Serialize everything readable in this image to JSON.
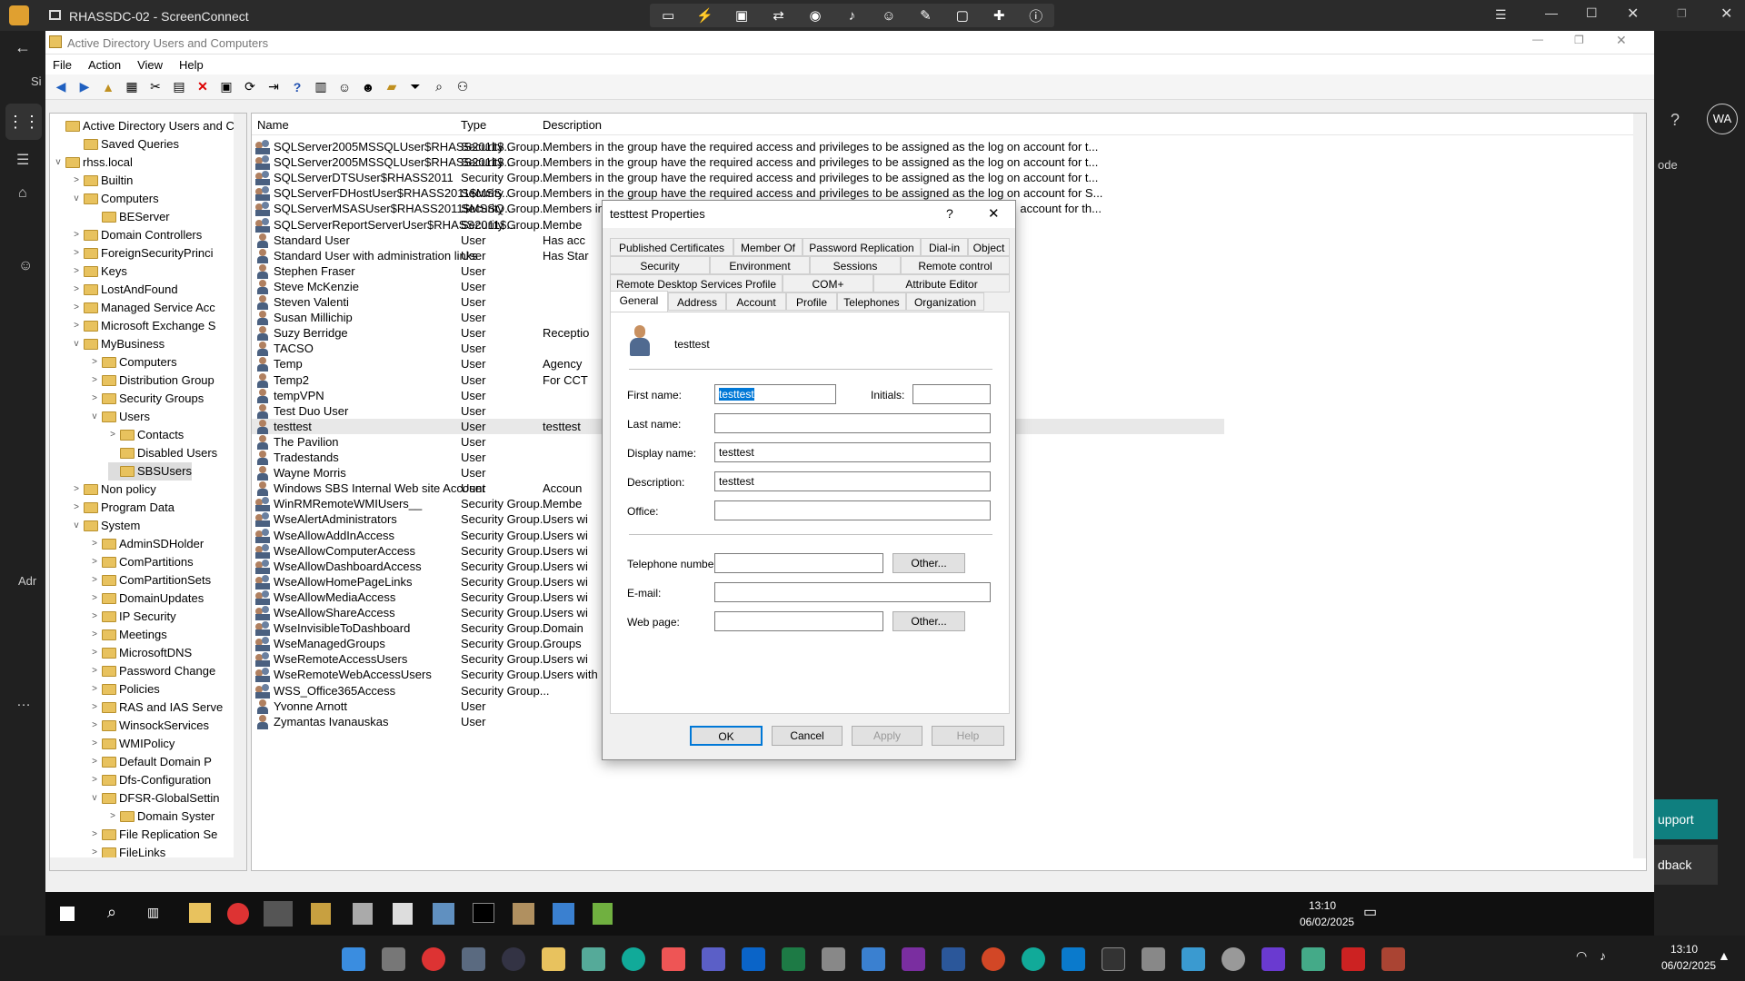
{
  "host": {
    "title": "RHASSDC-02 - ScreenConnect",
    "clock_time": "13:10",
    "clock_date": "06/02/2025"
  },
  "aduc": {
    "title": "Active Directory Users and Computers",
    "menu": [
      "File",
      "Action",
      "View",
      "Help"
    ]
  },
  "tree": [
    {
      "label": "Active Directory Users and Co",
      "indent": 0,
      "exp": ""
    },
    {
      "label": "Saved Queries",
      "indent": 1,
      "exp": ""
    },
    {
      "label": "rhss.local",
      "indent": 0,
      "exp": "v"
    },
    {
      "label": "Builtin",
      "indent": 1,
      "exp": ">"
    },
    {
      "label": "Computers",
      "indent": 1,
      "exp": "v"
    },
    {
      "label": "BEServer",
      "indent": 2,
      "exp": ""
    },
    {
      "label": "Domain Controllers",
      "indent": 1,
      "exp": ">"
    },
    {
      "label": "ForeignSecurityPrinci",
      "indent": 1,
      "exp": ">"
    },
    {
      "label": "Keys",
      "indent": 1,
      "exp": ">"
    },
    {
      "label": "LostAndFound",
      "indent": 1,
      "exp": ">"
    },
    {
      "label": "Managed Service Acc",
      "indent": 1,
      "exp": ">"
    },
    {
      "label": "Microsoft Exchange S",
      "indent": 1,
      "exp": ">"
    },
    {
      "label": "MyBusiness",
      "indent": 1,
      "exp": "v"
    },
    {
      "label": "Computers",
      "indent": 2,
      "exp": ">"
    },
    {
      "label": "Distribution Group",
      "indent": 2,
      "exp": ">"
    },
    {
      "label": "Security Groups",
      "indent": 2,
      "exp": ">"
    },
    {
      "label": "Users",
      "indent": 2,
      "exp": "v"
    },
    {
      "label": "Contacts",
      "indent": 3,
      "exp": ">"
    },
    {
      "label": "Disabled Users",
      "indent": 3,
      "exp": ""
    },
    {
      "label": "SBSUsers",
      "indent": 3,
      "exp": ""
    },
    {
      "label": "Non policy",
      "indent": 1,
      "exp": ">"
    },
    {
      "label": "Program Data",
      "indent": 1,
      "exp": ">"
    },
    {
      "label": "System",
      "indent": 1,
      "exp": "v"
    },
    {
      "label": "AdminSDHolder",
      "indent": 2,
      "exp": ">"
    },
    {
      "label": "ComPartitions",
      "indent": 2,
      "exp": ">"
    },
    {
      "label": "ComPartitionSets",
      "indent": 2,
      "exp": ">"
    },
    {
      "label": "DomainUpdates",
      "indent": 2,
      "exp": ">"
    },
    {
      "label": "IP Security",
      "indent": 2,
      "exp": ">"
    },
    {
      "label": "Meetings",
      "indent": 2,
      "exp": ">"
    },
    {
      "label": "MicrosoftDNS",
      "indent": 2,
      "exp": ">"
    },
    {
      "label": "Password Change",
      "indent": 2,
      "exp": ">"
    },
    {
      "label": "Policies",
      "indent": 2,
      "exp": ">"
    },
    {
      "label": "RAS and IAS Serve",
      "indent": 2,
      "exp": ">"
    },
    {
      "label": "WinsockServices",
      "indent": 2,
      "exp": ">"
    },
    {
      "label": "WMIPolicy",
      "indent": 2,
      "exp": ">"
    },
    {
      "label": "Default Domain P",
      "indent": 2,
      "exp": ">"
    },
    {
      "label": "Dfs-Configuration",
      "indent": 2,
      "exp": ">"
    },
    {
      "label": "DFSR-GlobalSettin",
      "indent": 2,
      "exp": "v"
    },
    {
      "label": "Domain Syster",
      "indent": 3,
      "exp": ">"
    },
    {
      "label": "File Replication Se",
      "indent": 2,
      "exp": ">"
    },
    {
      "label": "FileLinks",
      "indent": 2,
      "exp": ">"
    }
  ],
  "list": {
    "headers": [
      "Name",
      "Type",
      "Description"
    ],
    "rows": [
      {
        "name": "SQLServer2005MSSQLUser$RHASS2011$...",
        "type": "Security Group...",
        "desc": "Members in the group have the required access and privileges to be assigned as the log on account for t..."
      },
      {
        "name": "SQLServer2005MSSQLUser$RHASS2011$...",
        "type": "Security Group...",
        "desc": "Members in the group have the required access and privileges to be assigned as the log on account for t..."
      },
      {
        "name": "SQLServerDTSUser$RHASS2011",
        "type": "Security Group...",
        "desc": "Members in the group have the required access and privileges to be assigned as the log on account for t..."
      },
      {
        "name": "SQLServerFDHostUser$RHASS2011$MSS...",
        "type": "Security Group...",
        "desc": "Members in the group have the required access and privileges to be assigned as the log on account for S..."
      },
      {
        "name": "SQLServerMSASUser$RHASS2011$MSSQ...",
        "type": "Security Group...",
        "desc": "Members in the group have the required access and privileges to be assigned as the logon account for th..."
      },
      {
        "name": "SQLServerReportServerUser$RHASS2011$...",
        "type": "Security Group...",
        "desc": "Membe                                                                                     log on account for t..."
      },
      {
        "name": "Standard User",
        "type": "User",
        "desc": "Has acc                                                                                     arePoint Foundati..."
      },
      {
        "name": "Standard User with administration links",
        "type": "User",
        "desc": "Has Star                                                                                    te Web Access and ..."
      },
      {
        "name": "Stephen Fraser",
        "type": "User",
        "desc": ""
      },
      {
        "name": "Steve McKenzie",
        "type": "User",
        "desc": ""
      },
      {
        "name": "Steven Valenti",
        "type": "User",
        "desc": ""
      },
      {
        "name": "Susan Millichip",
        "type": "User",
        "desc": ""
      },
      {
        "name": "Suzy Berridge",
        "type": "User",
        "desc": "Receptio"
      },
      {
        "name": "TACSO",
        "type": "User",
        "desc": ""
      },
      {
        "name": "Temp",
        "type": "User",
        "desc": "Agency"
      },
      {
        "name": "Temp2",
        "type": "User",
        "desc": "For CCT"
      },
      {
        "name": "tempVPN",
        "type": "User",
        "desc": ""
      },
      {
        "name": "Test Duo User",
        "type": "User",
        "desc": ""
      },
      {
        "name": "testtest",
        "type": "User",
        "desc": "testtest"
      },
      {
        "name": "The Pavilion",
        "type": "User",
        "desc": ""
      },
      {
        "name": "Tradestands",
        "type": "User",
        "desc": ""
      },
      {
        "name": "Wayne Morris",
        "type": "User",
        "desc": ""
      },
      {
        "name": "Windows SBS Internal Web site Account",
        "type": "User",
        "desc": "Accoun                                                                                     able or delete this a..."
      },
      {
        "name": "WinRMRemoteWMIUsers__",
        "type": "Security Group...",
        "desc": "Membe                                                                                     ss WS-Managemen..."
      },
      {
        "name": "WseAlertAdministrators",
        "type": "Security Group...",
        "desc": "Users wi"
      },
      {
        "name": "WseAllowAddInAccess",
        "type": "Security Group...",
        "desc": "Users wi"
      },
      {
        "name": "WseAllowComputerAccess",
        "type": "Security Group...",
        "desc": "Users wi"
      },
      {
        "name": "WseAllowDashboardAccess",
        "type": "Security Group...",
        "desc": "Users wi"
      },
      {
        "name": "WseAllowHomePageLinks",
        "type": "Security Group...",
        "desc": "Users wi"
      },
      {
        "name": "WseAllowMediaAccess",
        "type": "Security Group...",
        "desc": "Users wi"
      },
      {
        "name": "WseAllowShareAccess",
        "type": "Security Group...",
        "desc": "Users wi"
      },
      {
        "name": "WseInvisibleToDashboard",
        "type": "Security Group...",
        "desc": "Domain"
      },
      {
        "name": "WseManagedGroups",
        "type": "Security Group...",
        "desc": "Groups"
      },
      {
        "name": "WseRemoteAccessUsers",
        "type": "Security Group...",
        "desc": "Users wi"
      },
      {
        "name": "WseRemoteWebAccessUsers",
        "type": "Security Group...",
        "desc": "Users with permissions to use Remote Web Access."
      },
      {
        "name": "WSS_Office365Access",
        "type": "Security Group...",
        "desc": ""
      },
      {
        "name": "Yvonne Arnott",
        "type": "User",
        "desc": ""
      },
      {
        "name": "Zymantas Ivanauskas",
        "type": "User",
        "desc": ""
      }
    ]
  },
  "dialog": {
    "title": "testtest Properties",
    "help": "?",
    "close": "✕",
    "tabs_row1": [
      "Published Certificates",
      "Member Of",
      "Password Replication",
      "Dial-in",
      "Object"
    ],
    "tabs_row2": [
      "Security",
      "Environment",
      "Sessions",
      "Remote control"
    ],
    "tabs_row3": [
      "Remote Desktop Services Profile",
      "COM+",
      "Attribute Editor"
    ],
    "tabs_row4": [
      "General",
      "Address",
      "Account",
      "Profile",
      "Telephones",
      "Organization"
    ],
    "user_name": "testtest",
    "labels": {
      "first": "First name:",
      "initials": "Initials:",
      "last": "Last name:",
      "display": "Display name:",
      "description": "Description:",
      "office": "Office:",
      "phone": "Telephone number:",
      "email": "E-mail:",
      "web": "Web page:"
    },
    "values": {
      "first": "testtest",
      "initials": "",
      "last": "",
      "display": "testtest",
      "description": "testtest",
      "office": "",
      "phone": "",
      "email": "",
      "web": ""
    },
    "other": "Other...",
    "buttons": {
      "ok": "OK",
      "cancel": "Cancel",
      "apply": "Apply",
      "help": "Help"
    }
  },
  "edge": {
    "sidebar_partial": [
      "Si",
      "Adr"
    ],
    "right_partial": [
      "ode",
      "upport",
      "dback"
    ],
    "avatar": "WA"
  }
}
